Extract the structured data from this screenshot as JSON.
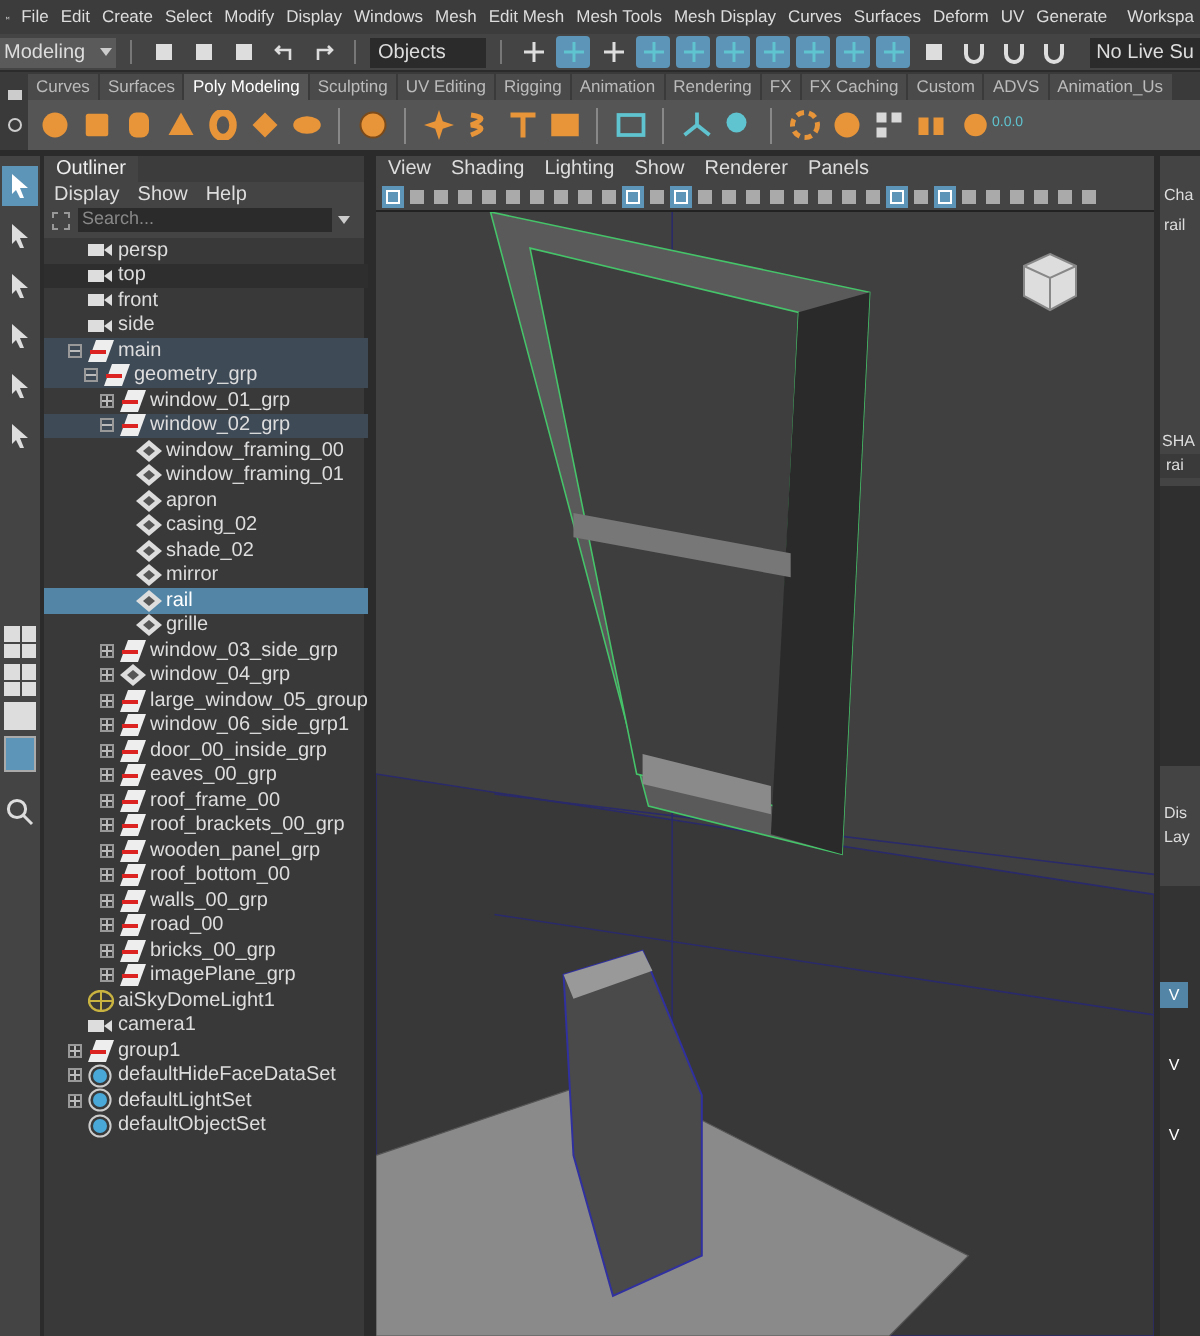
{
  "menu_bar": [
    "File",
    "Edit",
    "Create",
    "Select",
    "Modify",
    "Display",
    "Windows",
    "Mesh",
    "Edit Mesh",
    "Mesh Tools",
    "Mesh Display",
    "Curves",
    "Surfaces",
    "Deform",
    "UV",
    "Generate",
    "Workspa"
  ],
  "status_line": {
    "menu_set": "Modeling",
    "selection_mode": "Objects",
    "live_surface": "No Live Su",
    "component_buttons": [
      {
        "on": false
      },
      {
        "on": true
      },
      {
        "on": false
      },
      {
        "on": true
      },
      {
        "on": true
      },
      {
        "on": true
      },
      {
        "on": true
      },
      {
        "on": true
      },
      {
        "on": true
      },
      {
        "on": true
      }
    ]
  },
  "shelf_tabs": [
    {
      "label": "Curves",
      "selected": false
    },
    {
      "label": "Surfaces",
      "selected": false
    },
    {
      "label": "Poly Modeling",
      "selected": true
    },
    {
      "label": "Sculpting",
      "selected": false
    },
    {
      "label": "UV Editing",
      "selected": false
    },
    {
      "label": "Rigging",
      "selected": false
    },
    {
      "label": "Animation",
      "selected": false
    },
    {
      "label": "Rendering",
      "selected": false
    },
    {
      "label": "FX",
      "selected": false
    },
    {
      "label": "FX Caching",
      "selected": false
    },
    {
      "label": "Custom",
      "selected": false
    },
    {
      "label": "ADVS",
      "selected": false
    },
    {
      "label": "Animation_Us",
      "selected": false
    }
  ],
  "shelf_readout": "0.0.0",
  "toolbox": [
    {
      "selected": true
    },
    {
      "selected": false
    },
    {
      "selected": false
    },
    {
      "selected": false
    },
    {
      "selected": false
    },
    {
      "selected": false
    }
  ],
  "outliner": {
    "title": "Outliner",
    "menus": [
      "Display",
      "Show",
      "Help"
    ],
    "search": {
      "placeholder": "Search..."
    },
    "items": [
      {
        "label": "persp",
        "kind": "camera",
        "selected": false,
        "highlighted": false
      },
      {
        "label": "top",
        "kind": "camera",
        "selected": false,
        "highlighted": false
      },
      {
        "label": "front",
        "kind": "camera",
        "selected": false,
        "highlighted": false
      },
      {
        "label": "side",
        "kind": "camera",
        "selected": false,
        "highlighted": false
      },
      {
        "label": "main",
        "kind": "group",
        "selected": false,
        "highlighted": true,
        "expanded": true,
        "children": [
          {
            "label": "geometry_grp",
            "kind": "group",
            "selected": false,
            "highlighted": true,
            "expanded": true,
            "children": [
              {
                "label": "window_01_grp",
                "kind": "group",
                "selected": false,
                "highlighted": false,
                "expanded": false
              },
              {
                "label": "window_02_grp",
                "kind": "group",
                "selected": false,
                "highlighted": true,
                "expanded": true,
                "children": [
                  {
                    "label": "window_framing_00",
                    "kind": "mesh",
                    "selected": false,
                    "highlighted": false
                  },
                  {
                    "label": "window_framing_01",
                    "kind": "mesh",
                    "selected": false,
                    "highlighted": false
                  },
                  {
                    "label": "apron",
                    "kind": "mesh",
                    "selected": false,
                    "highlighted": false
                  },
                  {
                    "label": "casing_02",
                    "kind": "mesh",
                    "selected": false,
                    "highlighted": false
                  },
                  {
                    "label": "shade_02",
                    "kind": "mesh",
                    "selected": false,
                    "highlighted": false
                  },
                  {
                    "label": "mirror",
                    "kind": "mesh",
                    "selected": false,
                    "highlighted": false
                  },
                  {
                    "label": "rail",
                    "kind": "mesh",
                    "selected": true,
                    "highlighted": false
                  },
                  {
                    "label": "grille",
                    "kind": "mesh",
                    "selected": false,
                    "highlighted": false
                  }
                ]
              },
              {
                "label": "window_03_side_grp",
                "kind": "group",
                "selected": false,
                "highlighted": false,
                "expanded": false
              },
              {
                "label": "window_04_grp",
                "kind": "meshgroup",
                "selected": false,
                "highlighted": false,
                "expanded": false
              },
              {
                "label": "large_window_05_group",
                "kind": "group",
                "selected": false,
                "highlighted": false,
                "expanded": false
              },
              {
                "label": "window_06_side_grp1",
                "kind": "group",
                "selected": false,
                "highlighted": false,
                "expanded": false
              },
              {
                "label": "door_00_inside_grp",
                "kind": "group",
                "selected": false,
                "highlighted": false,
                "expanded": false
              },
              {
                "label": "eaves_00_grp",
                "kind": "group",
                "selected": false,
                "highlighted": false,
                "expanded": false
              },
              {
                "label": "roof_frame_00",
                "kind": "group",
                "selected": false,
                "highlighted": false,
                "expanded": false
              },
              {
                "label": "roof_brackets_00_grp",
                "kind": "group",
                "selected": false,
                "highlighted": false,
                "expanded": false
              },
              {
                "label": "wooden_panel_grp",
                "kind": "group",
                "selected": false,
                "highlighted": false,
                "expanded": false
              },
              {
                "label": "roof_bottom_00",
                "kind": "group",
                "selected": false,
                "highlighted": false,
                "expanded": false
              },
              {
                "label": "walls_00_grp",
                "kind": "group",
                "selected": false,
                "highlighted": false,
                "expanded": false
              },
              {
                "label": "road_00",
                "kind": "group",
                "selected": false,
                "highlighted": false,
                "expanded": false
              },
              {
                "label": "bricks_00_grp",
                "kind": "group",
                "selected": false,
                "highlighted": false,
                "expanded": false
              },
              {
                "label": "imagePlane_grp",
                "kind": "group",
                "selected": false,
                "highlighted": false,
                "expanded": false
              }
            ]
          }
        ]
      },
      {
        "label": "aiSkyDomeLight1",
        "kind": "light",
        "selected": false,
        "highlighted": false
      },
      {
        "label": "camera1",
        "kind": "camera",
        "selected": false,
        "highlighted": false
      },
      {
        "label": "group1",
        "kind": "group",
        "selected": false,
        "highlighted": false,
        "expanded": false
      },
      {
        "label": "defaultHideFaceDataSet",
        "kind": "set",
        "selected": false,
        "highlighted": false,
        "expanded": false
      },
      {
        "label": "defaultLightSet",
        "kind": "set",
        "selected": false,
        "highlighted": false,
        "expanded": false
      },
      {
        "label": "defaultObjectSet",
        "kind": "set",
        "selected": false,
        "highlighted": false
      }
    ]
  },
  "viewport": {
    "menus": [
      "View",
      "Shading",
      "Lighting",
      "Show",
      "Renderer",
      "Panels"
    ],
    "toolbar": [
      {
        "on": true
      },
      {
        "on": false
      },
      {
        "on": false
      },
      {
        "on": false
      },
      {
        "on": false
      },
      {
        "on": false
      },
      {
        "on": false
      },
      {
        "on": false
      },
      {
        "on": false
      },
      {
        "on": false
      },
      {
        "on": true
      },
      {
        "on": false
      },
      {
        "on": true
      },
      {
        "on": false
      },
      {
        "on": false
      },
      {
        "on": false
      },
      {
        "on": false
      },
      {
        "on": false
      },
      {
        "on": false
      },
      {
        "on": false
      },
      {
        "on": false
      },
      {
        "on": true
      },
      {
        "on": false
      },
      {
        "on": true
      },
      {
        "on": false
      },
      {
        "on": false
      },
      {
        "on": false
      },
      {
        "on": false
      },
      {
        "on": false
      },
      {
        "on": false
      }
    ]
  },
  "channel_box": {
    "title": "Cha",
    "object": "rail",
    "shapes_label": "SHA",
    "shape": "rai",
    "layer_tab": "Dis",
    "layer_menu": "Lay",
    "layers": [
      {
        "label": "V",
        "selected": true
      },
      {
        "label": "V",
        "selected": false
      },
      {
        "label": "V",
        "selected": false
      }
    ]
  }
}
